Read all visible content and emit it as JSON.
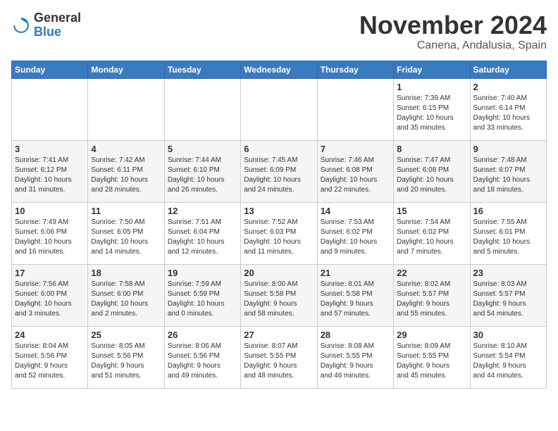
{
  "logo": {
    "text_general": "General",
    "text_blue": "Blue"
  },
  "title": "November 2024",
  "location": "Canena, Andalusia, Spain",
  "days_header": [
    "Sunday",
    "Monday",
    "Tuesday",
    "Wednesday",
    "Thursday",
    "Friday",
    "Saturday"
  ],
  "weeks": [
    {
      "days": [
        {
          "num": "",
          "info": ""
        },
        {
          "num": "",
          "info": ""
        },
        {
          "num": "",
          "info": ""
        },
        {
          "num": "",
          "info": ""
        },
        {
          "num": "",
          "info": ""
        },
        {
          "num": "1",
          "info": "Sunrise: 7:39 AM\nSunset: 6:15 PM\nDaylight: 10 hours\nand 35 minutes."
        },
        {
          "num": "2",
          "info": "Sunrise: 7:40 AM\nSunset: 6:14 PM\nDaylight: 10 hours\nand 33 minutes."
        }
      ]
    },
    {
      "days": [
        {
          "num": "3",
          "info": "Sunrise: 7:41 AM\nSunset: 6:12 PM\nDaylight: 10 hours\nand 31 minutes."
        },
        {
          "num": "4",
          "info": "Sunrise: 7:42 AM\nSunset: 6:11 PM\nDaylight: 10 hours\nand 28 minutes."
        },
        {
          "num": "5",
          "info": "Sunrise: 7:44 AM\nSunset: 6:10 PM\nDaylight: 10 hours\nand 26 minutes."
        },
        {
          "num": "6",
          "info": "Sunrise: 7:45 AM\nSunset: 6:09 PM\nDaylight: 10 hours\nand 24 minutes."
        },
        {
          "num": "7",
          "info": "Sunrise: 7:46 AM\nSunset: 6:08 PM\nDaylight: 10 hours\nand 22 minutes."
        },
        {
          "num": "8",
          "info": "Sunrise: 7:47 AM\nSunset: 6:08 PM\nDaylight: 10 hours\nand 20 minutes."
        },
        {
          "num": "9",
          "info": "Sunrise: 7:48 AM\nSunset: 6:07 PM\nDaylight: 10 hours\nand 18 minutes."
        }
      ]
    },
    {
      "days": [
        {
          "num": "10",
          "info": "Sunrise: 7:49 AM\nSunset: 6:06 PM\nDaylight: 10 hours\nand 16 minutes."
        },
        {
          "num": "11",
          "info": "Sunrise: 7:50 AM\nSunset: 6:05 PM\nDaylight: 10 hours\nand 14 minutes."
        },
        {
          "num": "12",
          "info": "Sunrise: 7:51 AM\nSunset: 6:04 PM\nDaylight: 10 hours\nand 12 minutes."
        },
        {
          "num": "13",
          "info": "Sunrise: 7:52 AM\nSunset: 6:03 PM\nDaylight: 10 hours\nand 11 minutes."
        },
        {
          "num": "14",
          "info": "Sunrise: 7:53 AM\nSunset: 6:02 PM\nDaylight: 10 hours\nand 9 minutes."
        },
        {
          "num": "15",
          "info": "Sunrise: 7:54 AM\nSunset: 6:02 PM\nDaylight: 10 hours\nand 7 minutes."
        },
        {
          "num": "16",
          "info": "Sunrise: 7:55 AM\nSunset: 6:01 PM\nDaylight: 10 hours\nand 5 minutes."
        }
      ]
    },
    {
      "days": [
        {
          "num": "17",
          "info": "Sunrise: 7:56 AM\nSunset: 6:00 PM\nDaylight: 10 hours\nand 3 minutes."
        },
        {
          "num": "18",
          "info": "Sunrise: 7:58 AM\nSunset: 6:00 PM\nDaylight: 10 hours\nand 2 minutes."
        },
        {
          "num": "19",
          "info": "Sunrise: 7:59 AM\nSunset: 5:59 PM\nDaylight: 10 hours\nand 0 minutes."
        },
        {
          "num": "20",
          "info": "Sunrise: 8:00 AM\nSunset: 5:58 PM\nDaylight: 9 hours\nand 58 minutes."
        },
        {
          "num": "21",
          "info": "Sunrise: 8:01 AM\nSunset: 5:58 PM\nDaylight: 9 hours\nand 57 minutes."
        },
        {
          "num": "22",
          "info": "Sunrise: 8:02 AM\nSunset: 5:57 PM\nDaylight: 9 hours\nand 55 minutes."
        },
        {
          "num": "23",
          "info": "Sunrise: 8:03 AM\nSunset: 5:57 PM\nDaylight: 9 hours\nand 54 minutes."
        }
      ]
    },
    {
      "days": [
        {
          "num": "24",
          "info": "Sunrise: 8:04 AM\nSunset: 5:56 PM\nDaylight: 9 hours\nand 52 minutes."
        },
        {
          "num": "25",
          "info": "Sunrise: 8:05 AM\nSunset: 5:56 PM\nDaylight: 9 hours\nand 51 minutes."
        },
        {
          "num": "26",
          "info": "Sunrise: 8:06 AM\nSunset: 5:56 PM\nDaylight: 9 hours\nand 49 minutes."
        },
        {
          "num": "27",
          "info": "Sunrise: 8:07 AM\nSunset: 5:55 PM\nDaylight: 9 hours\nand 48 minutes."
        },
        {
          "num": "28",
          "info": "Sunrise: 8:08 AM\nSunset: 5:55 PM\nDaylight: 9 hours\nand 46 minutes."
        },
        {
          "num": "29",
          "info": "Sunrise: 8:09 AM\nSunset: 5:55 PM\nDaylight: 9 hours\nand 45 minutes."
        },
        {
          "num": "30",
          "info": "Sunrise: 8:10 AM\nSunset: 5:54 PM\nDaylight: 9 hours\nand 44 minutes."
        }
      ]
    }
  ]
}
